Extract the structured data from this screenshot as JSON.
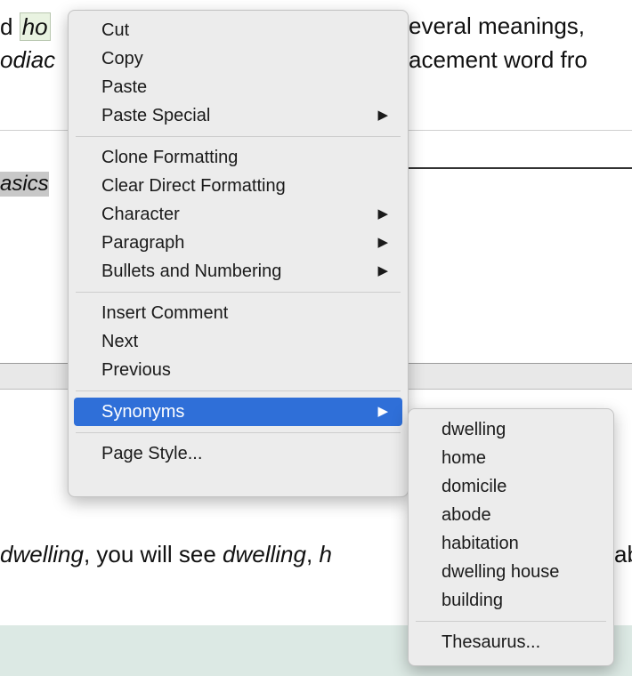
{
  "document": {
    "line1_a": "d ",
    "line1_word": "ho",
    "line1_b": "everal meanings,",
    "line2_a": "odiac",
    "line2_b": "acement word fro",
    "heading_fragment": "asics",
    "bottom_a": "dwelling",
    "bottom_b": ", you will see ",
    "bottom_c": "dwelling",
    "bottom_d": ", ",
    "bottom_e": "h",
    "bottom_f": "ab"
  },
  "context_menu": {
    "groups": [
      [
        {
          "label": "Cut"
        },
        {
          "label": "Copy"
        },
        {
          "label": "Paste"
        },
        {
          "label": "Paste Special",
          "submenu": true
        }
      ],
      [
        {
          "label": "Clone Formatting"
        },
        {
          "label": "Clear Direct Formatting"
        },
        {
          "label": "Character",
          "submenu": true
        },
        {
          "label": "Paragraph",
          "submenu": true
        },
        {
          "label": "Bullets and Numbering",
          "submenu": true
        }
      ],
      [
        {
          "label": "Insert Comment"
        },
        {
          "label": "Next"
        },
        {
          "label": "Previous"
        }
      ],
      [
        {
          "label": "Synonyms",
          "submenu": true,
          "active": true
        }
      ],
      [
        {
          "label": "Page Style..."
        }
      ]
    ],
    "arrow_glyph": "▶",
    "active_color": "#2f6fd8"
  },
  "synonyms_submenu": {
    "items": [
      "dwelling",
      "home",
      "domicile",
      "abode",
      "habitation",
      "dwelling house",
      "building"
    ],
    "footer": "Thesaurus..."
  }
}
